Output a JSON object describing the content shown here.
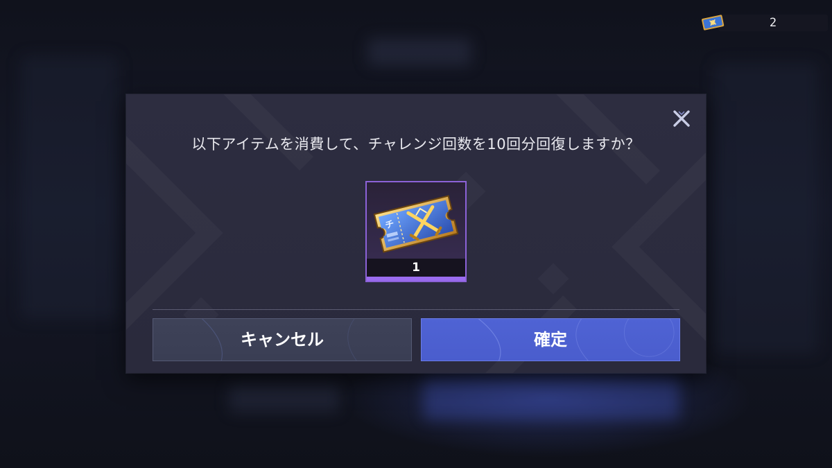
{
  "currency": {
    "icon": "challenge-ticket-icon",
    "count": "2"
  },
  "dialog": {
    "message": "以下アイテムを消費して、チャレンジ回数を10回分回復しますか？",
    "close_icon": "close-icon",
    "item": {
      "icon": "challenge-ticket-icon",
      "quantity": "1",
      "rarity_color": "#9b6cf0"
    },
    "cancel_label": "キャンセル",
    "confirm_label": "確定"
  },
  "colors": {
    "confirm": "#4f63d4",
    "cancel": "#3e4258",
    "modal": "#2d2d40"
  }
}
